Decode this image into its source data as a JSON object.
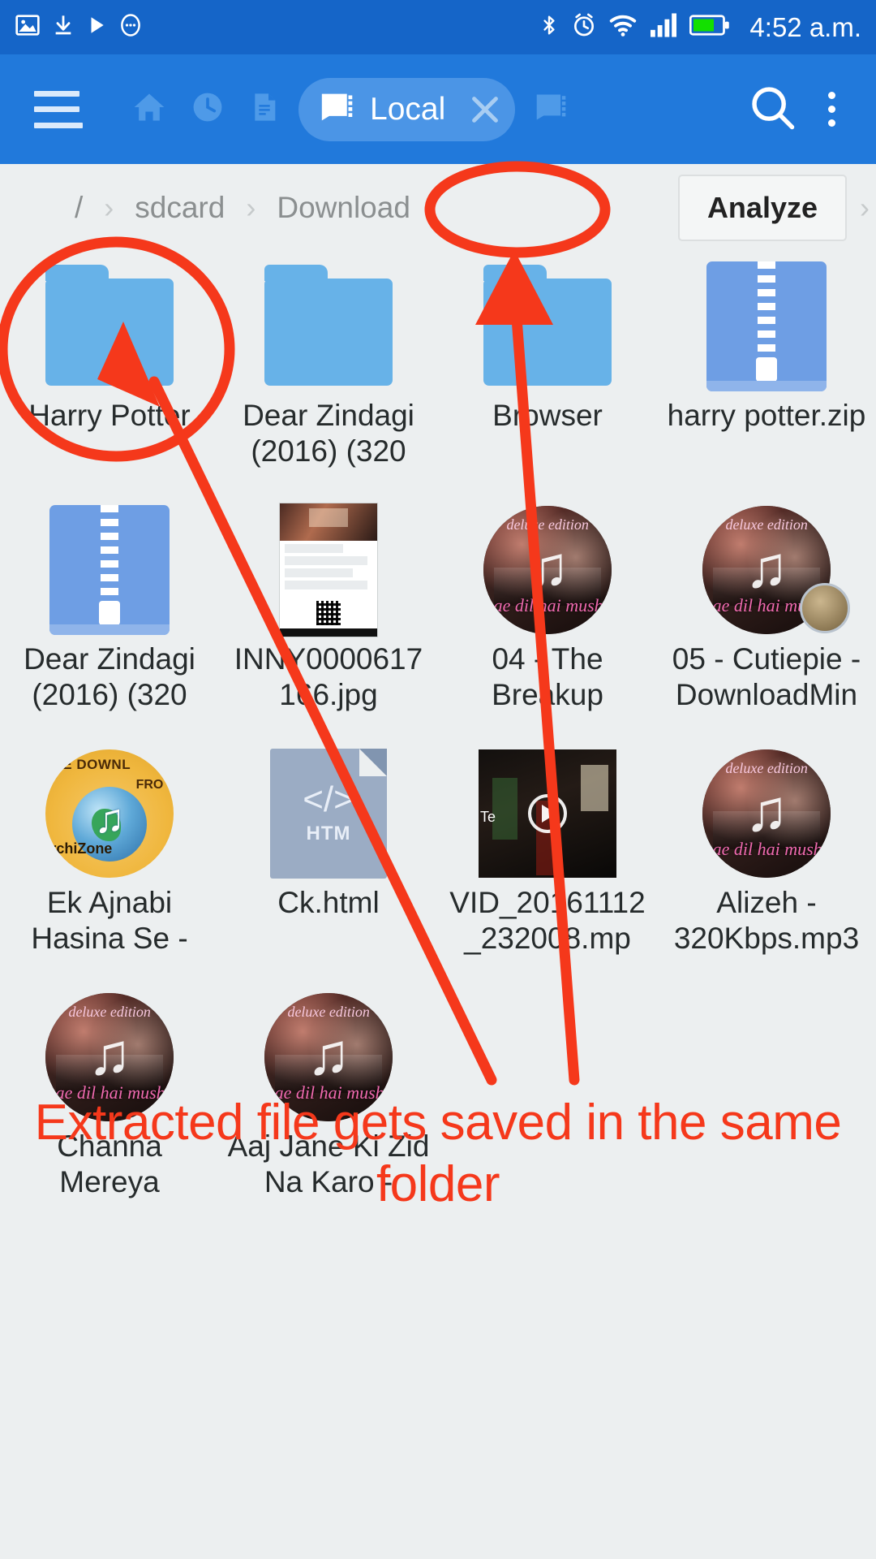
{
  "status_bar": {
    "left_icons": [
      "image-icon",
      "download-icon",
      "play-icon",
      "more-circle-icon"
    ],
    "right_icons": [
      "bluetooth-icon",
      "alarm-icon",
      "wifi-icon",
      "signal-icon",
      "battery-icon"
    ],
    "time": "4:52 a.m.",
    "background_color": "#1565c8",
    "battery_color": "#13e000"
  },
  "toolbar": {
    "menu_label": "menu",
    "nav_icons": [
      "home-icon",
      "recent-clock-icon",
      "notes-icon"
    ],
    "tab": {
      "label": "Local",
      "icon": "sdcard-icon",
      "close_label": "×"
    },
    "extra_tab_icon": "sdcard-icon",
    "search_label": "search",
    "overflow_label": "more options",
    "background_color": "#2179db",
    "tab_chip_color": "#4b95e6"
  },
  "breadcrumb": {
    "items": [
      "/",
      "sdcard",
      "Download"
    ],
    "separator": "›",
    "analyze_label": "Analyze",
    "trailing_chevron": "›",
    "background_color": "#eceff0"
  },
  "files": [
    {
      "name": "Harry Potter",
      "type": "folder",
      "icon": "folder-icon"
    },
    {
      "name": "Dear Zindagi (2016) (320",
      "type": "folder",
      "icon": "folder-icon"
    },
    {
      "name": "Browser",
      "type": "folder",
      "icon": "folder-icon"
    },
    {
      "name": "harry potter.zip",
      "type": "archive",
      "icon": "zip-icon"
    },
    {
      "name": "Dear Zindagi (2016) (320",
      "type": "archive",
      "icon": "zip-icon"
    },
    {
      "name": "INNY0000617166.jpg",
      "type": "image",
      "icon": "image-thumbnail"
    },
    {
      "name": "04 - The Breakup",
      "type": "audio",
      "icon": "album-art"
    },
    {
      "name": "05 - Cutiepie - DownloadMin",
      "type": "audio",
      "icon": "album-art"
    },
    {
      "name": "Ek Ajnabi Hasina Se -",
      "type": "audio",
      "icon": "globe-mp3-icon"
    },
    {
      "name": "Ck.html",
      "type": "html",
      "icon": "html-file-icon",
      "ext_label": "HTM",
      "glyph": "</>"
    },
    {
      "name": "VID_20161112_232008.mp",
      "type": "video",
      "icon": "video-thumbnail",
      "overlay_text": "Te"
    },
    {
      "name": "Alizeh - 320Kbps.mp3",
      "type": "audio",
      "icon": "album-art"
    },
    {
      "name": "Channa Mereya",
      "type": "audio",
      "icon": "album-art"
    },
    {
      "name": "Aaj Jane Ki Zid Na Karo -",
      "type": "audio",
      "icon": "album-art"
    }
  ],
  "annotation": {
    "text": "Extracted file gets saved in the same folder",
    "color": "#f5381b",
    "circled_items": [
      "Harry Potter",
      "Download"
    ],
    "arrow_count": 2
  }
}
